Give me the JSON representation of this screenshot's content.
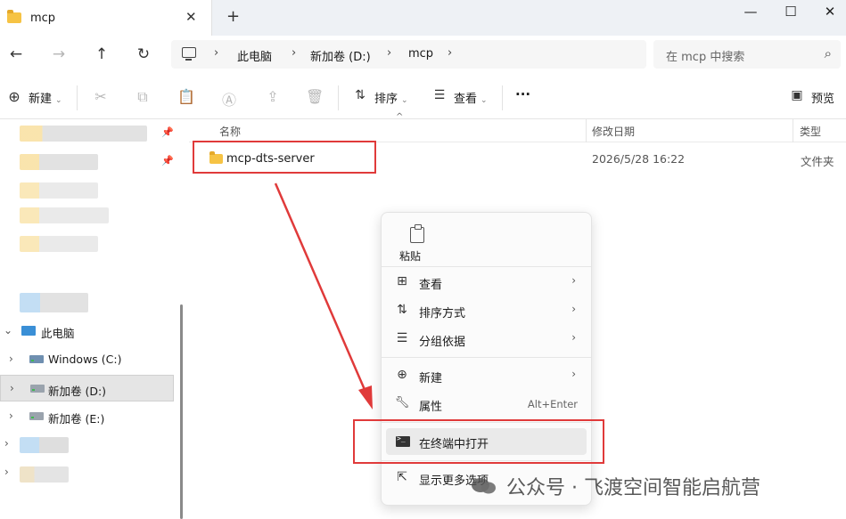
{
  "window": {
    "tab_title": "mcp",
    "tab_close": "✕",
    "new_tab": "+",
    "minimize": "—",
    "maximize": "☐",
    "close": "✕"
  },
  "nav": {
    "back": "←",
    "forward": "→",
    "up": "↑",
    "refresh": "↻",
    "breadcrumb": [
      "此电脑",
      "新加卷 (D:)",
      "mcp"
    ],
    "chevron": "›",
    "search_placeholder": "在 mcp 中搜索",
    "search_icon": "⌕"
  },
  "toolbar": {
    "new_label": "新建",
    "sort_label": "排序",
    "view_label": "查看",
    "more": "···",
    "preview_label": "预览",
    "caret": "⌄"
  },
  "sidebar": {
    "this_pc": "此电脑",
    "drives": [
      {
        "label": "Windows (C:)",
        "selected": false
      },
      {
        "label": "新加卷 (D:)",
        "selected": true
      },
      {
        "label": "新加卷 (E:)",
        "selected": false
      }
    ],
    "chevron_closed": "›",
    "chevron_open": "⌄"
  },
  "content": {
    "columns": {
      "name": "名称",
      "modified": "修改日期",
      "type": "类型"
    },
    "files": [
      {
        "name": "mcp-dts-server",
        "modified": "2026/5/28 16:22",
        "type": "文件夹"
      }
    ],
    "sort_caret": "^"
  },
  "context_menu": {
    "paste_label": "粘贴",
    "items": [
      {
        "label": "查看",
        "icon": "view-grid-icon",
        "glyph": "⊞",
        "submenu": true
      },
      {
        "label": "排序方式",
        "icon": "sort-icon",
        "glyph": "⇅",
        "submenu": true
      },
      {
        "label": "分组依据",
        "icon": "group-icon",
        "glyph": "☰",
        "submenu": true
      },
      {
        "label": "新建",
        "icon": "new-icon",
        "glyph": "⊕",
        "submenu": true
      },
      {
        "label": "属性",
        "icon": "wrench-icon",
        "glyph": "🔧",
        "shortcut": "Alt+Enter"
      },
      {
        "label": "在终端中打开",
        "icon": "terminal-icon"
      },
      {
        "label": "显示更多选项",
        "icon": "more-options-icon",
        "glyph": "⇱"
      }
    ],
    "arrow": "›"
  },
  "watermark": {
    "text": "公众号 · 飞渡空间智能启航营"
  },
  "colors": {
    "annotation_red": "#e03a3a",
    "folder_yellow": "#f6c344",
    "selected_bg": "#e5e5e5"
  }
}
